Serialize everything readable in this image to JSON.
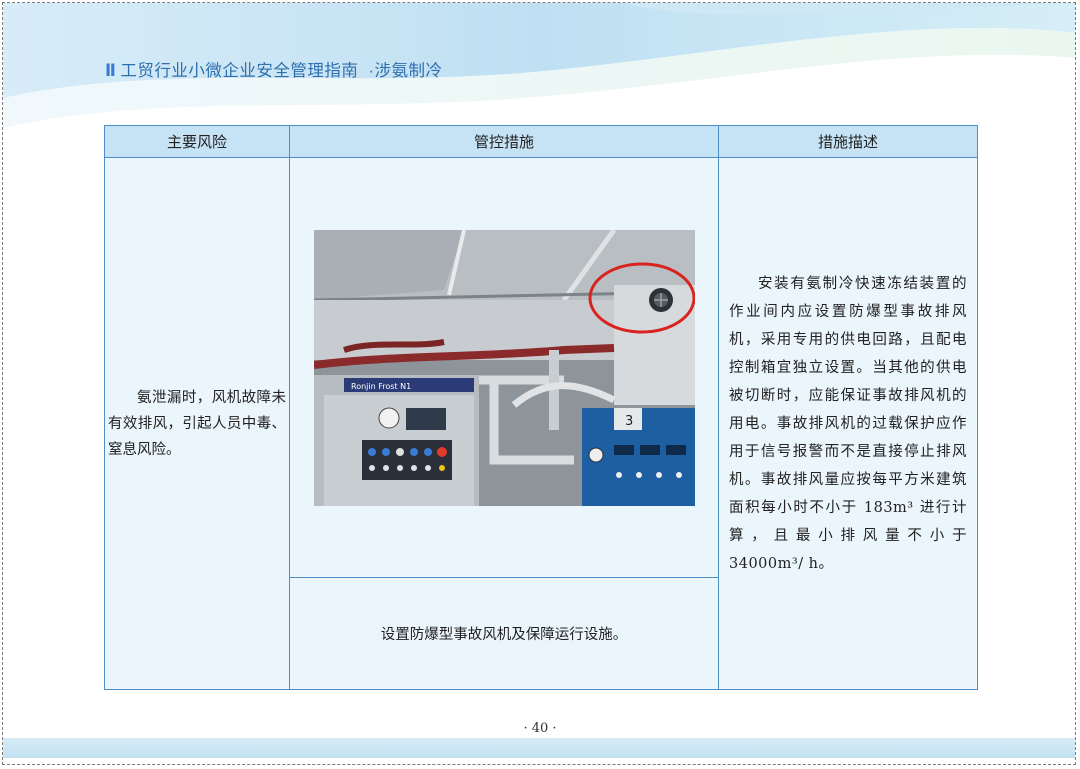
{
  "header": {
    "bar": "Ⅱ",
    "title": "工贸行业小微企业安全管理指南",
    "subtitle": "·涉氨制冷"
  },
  "table": {
    "headers": [
      "主要风险",
      "管控措施",
      "措施描述"
    ],
    "risk": "氨泄漏时，风机故障未有效排风，引起人员中毒、窒息风险。",
    "measure": "设置防爆型事故风机及保障运行设施。",
    "description": "安装有氨制冷快速冻结装置的作业间内应设置防爆型事故排风机，采用专用的供电回路，且配电控制箱宜独立设置。当其他的供电被切断时，应能保证事故排风机的用电。事故排风机的过载保护应作用于信号报警而不是直接停止排风机。事故排风量应按每平方米建筑面积每小时不小于 183m³ 进行计算，且最小排风量不小于 34000m³/ h。"
  },
  "photo": {
    "machine_label": "Ronjin Frost N1",
    "panel_number": "3",
    "highlight_color": "#d8231f"
  },
  "footer": {
    "page_number": "· 40 ·"
  },
  "colors": {
    "header_fill": "#c6e3f6",
    "cell_fill": "#eaf5fc",
    "border": "#4e8fc8",
    "title_text": "#2f6fae"
  }
}
